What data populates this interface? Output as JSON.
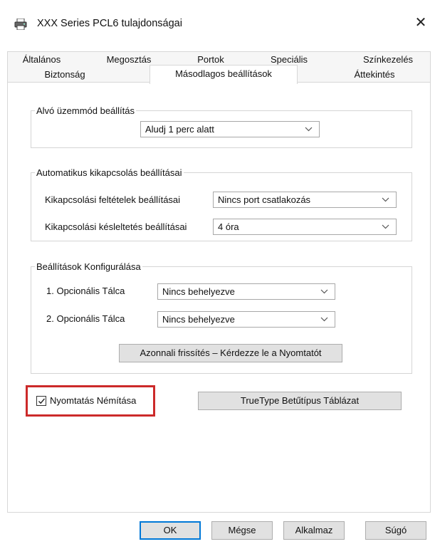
{
  "window": {
    "title": "XXX Series PCL6 tulajdonságai",
    "close_symbol": "✕",
    "app_icon": "printer-icon"
  },
  "tabs": {
    "row_top": [
      "Általános",
      "Megosztás",
      "Portok",
      "Speciális",
      "Színkezelés"
    ],
    "row_mid": [
      "Biztonság",
      "Másodlagos beállítások",
      "Áttekintés"
    ],
    "active": "Másodlagos beállítások"
  },
  "sleep_group": {
    "legend": "Alvó üzemmód beállítás",
    "select_value": "Aludj 1 perc alatt"
  },
  "auto_off_group": {
    "legend": "Automatikus kikapcsolás beállításai",
    "condition_label": "Kikapcsolási feltételek beállításai",
    "condition_value": "Nincs port csatlakozás",
    "delay_label": "Kikapcsolási késleltetés beállításai",
    "delay_value": "4 óra"
  },
  "config_group": {
    "legend": "Beállítások Konfigurálása",
    "tray1_label": "1. Opcionális Tálca",
    "tray1_value": "Nincs behelyezve",
    "tray2_label": "2. Opcionális Tálca",
    "tray2_value": "Nincs behelyezve",
    "refresh_button": "Azonnali frissítés – Kérdezze le a Nyomtatót"
  },
  "options": {
    "mute_label": "Nyomtatás Némítása",
    "mute_checked": true,
    "truetype_button": "TrueType Betűtípus Táblázat",
    "highlight_color": "#cc2a2a"
  },
  "footer": {
    "ok": "OK",
    "cancel": "Mégse",
    "apply": "Alkalmaz",
    "help": "Súgó"
  }
}
